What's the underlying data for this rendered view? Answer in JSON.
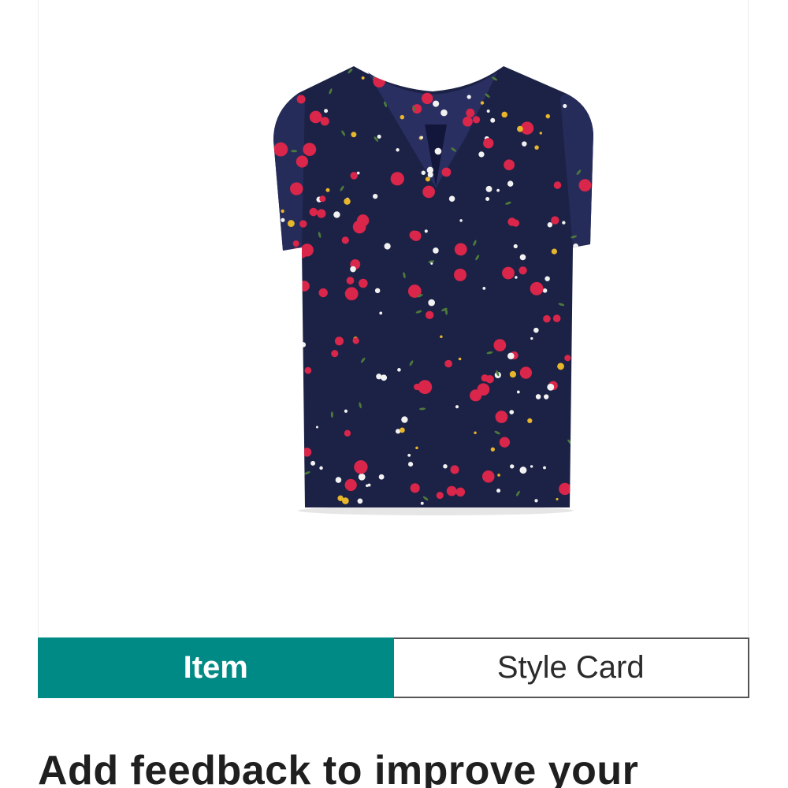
{
  "product": {
    "image_alt": "Navy floral print cap-sleeve blouse",
    "colors": {
      "navy": "#1c2245",
      "red": "#d9264a",
      "yellow": "#e8b62a",
      "white": "#f2f2f2",
      "green": "#4d7a3b"
    }
  },
  "tabs": {
    "item_label": "Item",
    "style_card_label": "Style Card",
    "active_color": "#008a86"
  },
  "feedback": {
    "heading": "Add feedback to improve your"
  }
}
